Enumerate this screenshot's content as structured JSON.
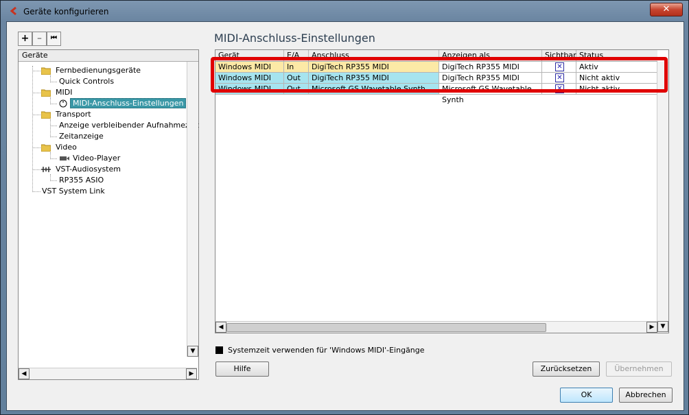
{
  "window": {
    "title": "Geräte konfigurieren",
    "close_glyph": "✕"
  },
  "toolbar": {
    "add": "+",
    "remove": "–",
    "reset": "⏮"
  },
  "devices_panel": {
    "header": "Geräte",
    "items": [
      {
        "label": "Fernbedienungsgeräte"
      },
      {
        "label": "Quick Controls"
      },
      {
        "label": "MIDI"
      },
      {
        "label": "MIDI-Anschluss-Einstellungen"
      },
      {
        "label": "Transport"
      },
      {
        "label": "Anzeige verbleibender Aufnahmezeit"
      },
      {
        "label": "Zeitanzeige"
      },
      {
        "label": "Video"
      },
      {
        "label": "Video-Player"
      },
      {
        "label": "VST-Audiosystem"
      },
      {
        "label": "RP355 ASIO"
      },
      {
        "label": "VST System Link"
      }
    ]
  },
  "section_title": "MIDI-Anschluss-Einstellungen",
  "table": {
    "columns": [
      "Gerät",
      "E/A",
      "Anschluss",
      "Anzeigen als",
      "Sichtbar",
      "Status"
    ],
    "rows": [
      {
        "device": "Windows MIDI",
        "io": "In",
        "port": "DigiTech RP355 MIDI",
        "show_as": "DigiTech RP355 MIDI",
        "visible": "✕",
        "status": "Aktiv",
        "color": "#fce9a6"
      },
      {
        "device": "Windows MIDI",
        "io": "Out",
        "port": "DigiTech RP355 MIDI",
        "show_as": "DigiTech RP355 MIDI",
        "visible": "✕",
        "status": "Nicht aktiv",
        "color": "#a6e4ef"
      },
      {
        "device": "Windows MIDI",
        "io": "Out",
        "port": "Microsoft GS Wavetable Synth",
        "show_as": "Microsoft GS Wavetable Synth",
        "visible": "✕",
        "status": "Nicht aktiv",
        "color": "#a6e4ef"
      }
    ]
  },
  "system_time": {
    "label": "Systemzeit verwenden für 'Windows MIDI'-Eingänge"
  },
  "buttons": {
    "help": "Hilfe",
    "reset": "Zurücksetzen",
    "apply": "Übernehmen",
    "ok": "OK",
    "cancel": "Abbrechen"
  },
  "scroll": {
    "up": "▲",
    "down": "▼",
    "left": "◀",
    "right": "▶"
  }
}
